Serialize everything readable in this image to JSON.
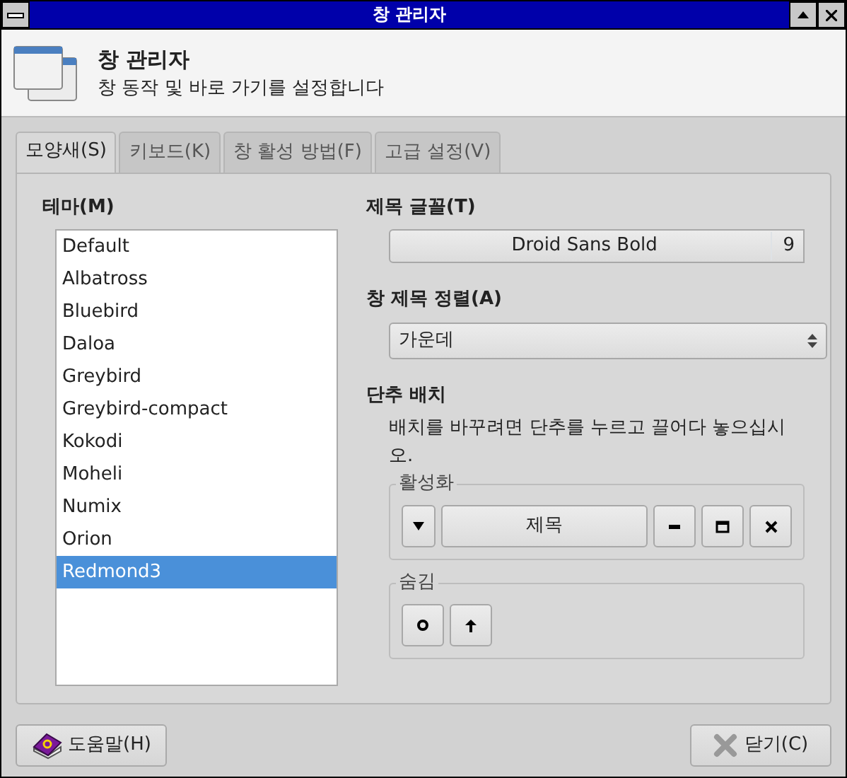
{
  "window": {
    "title": "창 관리자"
  },
  "header": {
    "title": "창 관리자",
    "subtitle": "창 동작 및 바로 가기를 설정합니다"
  },
  "tabs": [
    {
      "label": "모양새(S)",
      "selected": true
    },
    {
      "label": "키보드(K)",
      "selected": false
    },
    {
      "label": "창 활성 방법(F)",
      "selected": false
    },
    {
      "label": "고급 설정(V)",
      "selected": false
    }
  ],
  "theme": {
    "label": "테마(M)",
    "items": [
      {
        "name": "Default",
        "selected": false
      },
      {
        "name": "Albatross",
        "selected": false
      },
      {
        "name": "Bluebird",
        "selected": false
      },
      {
        "name": "Daloa",
        "selected": false
      },
      {
        "name": "Greybird",
        "selected": false
      },
      {
        "name": "Greybird-compact",
        "selected": false
      },
      {
        "name": "Kokodi",
        "selected": false
      },
      {
        "name": "Moheli",
        "selected": false
      },
      {
        "name": "Numix",
        "selected": false
      },
      {
        "name": "Orion",
        "selected": false
      },
      {
        "name": "Redmond3",
        "selected": true
      }
    ]
  },
  "title_font": {
    "label": "제목 글꼴(T)",
    "font": "Droid Sans Bold",
    "size": "9"
  },
  "title_alignment": {
    "label": "창 제목 정렬(A)",
    "value": "가운데"
  },
  "button_layout": {
    "label": "단추 배치",
    "hint": "배치를 바꾸려면 단추를 누르고 끌어다 놓으십시오.",
    "active": {
      "label": "활성화",
      "buttons": [
        {
          "kind": "menu"
        },
        {
          "kind": "title",
          "label": "제목"
        },
        {
          "kind": "minimize"
        },
        {
          "kind": "maximize"
        },
        {
          "kind": "close"
        }
      ]
    },
    "hidden": {
      "label": "숨김",
      "buttons": [
        {
          "kind": "stick"
        },
        {
          "kind": "shade"
        }
      ]
    }
  },
  "footer": {
    "help": "도움말(H)",
    "close": "닫기(C)"
  }
}
